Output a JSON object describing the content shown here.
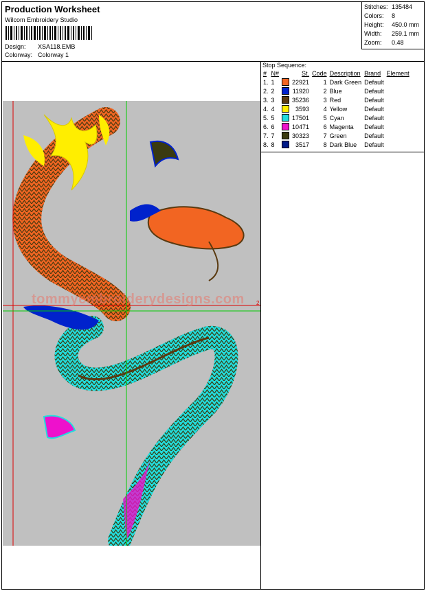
{
  "header": {
    "title": "Production Worksheet",
    "software": "Wilcom Embroidery Studio",
    "design_label": "Design:",
    "design_value": "XSA118.EMB",
    "colorway_label": "Colorway:",
    "colorway_value": "Colorway 1"
  },
  "stats": [
    {
      "label": "Stitches:",
      "value": "135484"
    },
    {
      "label": "Colors:",
      "value": "8"
    },
    {
      "label": "Height:",
      "value": "450.0 mm"
    },
    {
      "label": "Width:",
      "value": "259.1 mm"
    },
    {
      "label": "Zoom:",
      "value": "0.48"
    }
  ],
  "stop_sequence": {
    "caption": "Stop Sequence:",
    "columns": [
      "#",
      "N#",
      "St.",
      "Code",
      "Description",
      "Brand",
      "Element"
    ],
    "rows": [
      {
        "n": "1.",
        "nn": "1",
        "color": "#f26522",
        "st": "22921",
        "code": "1",
        "desc": "Dark Green",
        "brand": "Default",
        "element": ""
      },
      {
        "n": "2.",
        "nn": "2",
        "color": "#0022cc",
        "st": "11920",
        "code": "2",
        "desc": "Blue",
        "brand": "Default",
        "element": ""
      },
      {
        "n": "3.",
        "nn": "3",
        "color": "#5a3a10",
        "st": "35236",
        "code": "3",
        "desc": "Red",
        "brand": "Default",
        "element": ""
      },
      {
        "n": "4.",
        "nn": "4",
        "color": "#ffee00",
        "st": "3593",
        "code": "4",
        "desc": "Yellow",
        "brand": "Default",
        "element": ""
      },
      {
        "n": "5.",
        "nn": "5",
        "color": "#22dddd",
        "st": "17501",
        "code": "5",
        "desc": "Cyan",
        "brand": "Default",
        "element": ""
      },
      {
        "n": "6.",
        "nn": "6",
        "color": "#ee11cc",
        "st": "10471",
        "code": "6",
        "desc": "Magenta",
        "brand": "Default",
        "element": ""
      },
      {
        "n": "7.",
        "nn": "7",
        "color": "#3a3a10",
        "st": "30323",
        "code": "7",
        "desc": "Green",
        "brand": "Default",
        "element": ""
      },
      {
        "n": "8.",
        "nn": "8",
        "color": "#001a88",
        "st": "3517",
        "code": "8",
        "desc": "Dark Blue",
        "brand": "Default",
        "element": ""
      }
    ]
  },
  "preview": {
    "watermark": "tommyembroiderydesigns.com",
    "hoop_marker": "2",
    "background": "#c0c0c0",
    "axis_color": "#00cc00",
    "hoop_color": "#dd0000"
  }
}
